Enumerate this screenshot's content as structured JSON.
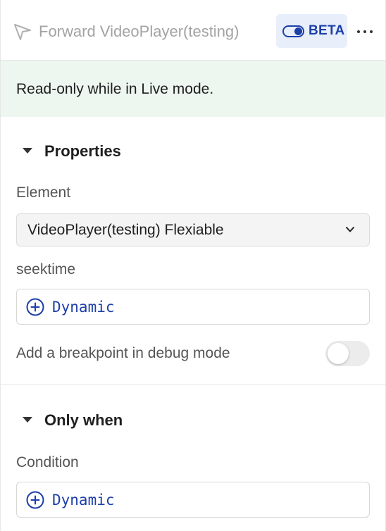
{
  "header": {
    "title": "Forward VideoPlayer(testing)",
    "action_icon": "send-arrow-icon",
    "badge_label": "BETA",
    "badge_icon": "toggle-on-icon",
    "more_icon": "more-horizontal-icon"
  },
  "notice": {
    "text": "Read-only while in Live mode."
  },
  "properties": {
    "section_title": "Properties",
    "element_label": "Element",
    "element_value": "VideoPlayer(testing) Flexiable",
    "seektime_label": "seektime",
    "seektime_value": "Dynamic",
    "breakpoint_label": "Add a breakpoint in debug mode",
    "breakpoint_enabled": false
  },
  "only_when": {
    "section_title": "Only when",
    "condition_label": "Condition",
    "condition_value": "Dynamic"
  },
  "colors": {
    "accent": "#1d3fa8",
    "notice_bg": "#eef6f0",
    "badge_bg": "#e8effb"
  }
}
